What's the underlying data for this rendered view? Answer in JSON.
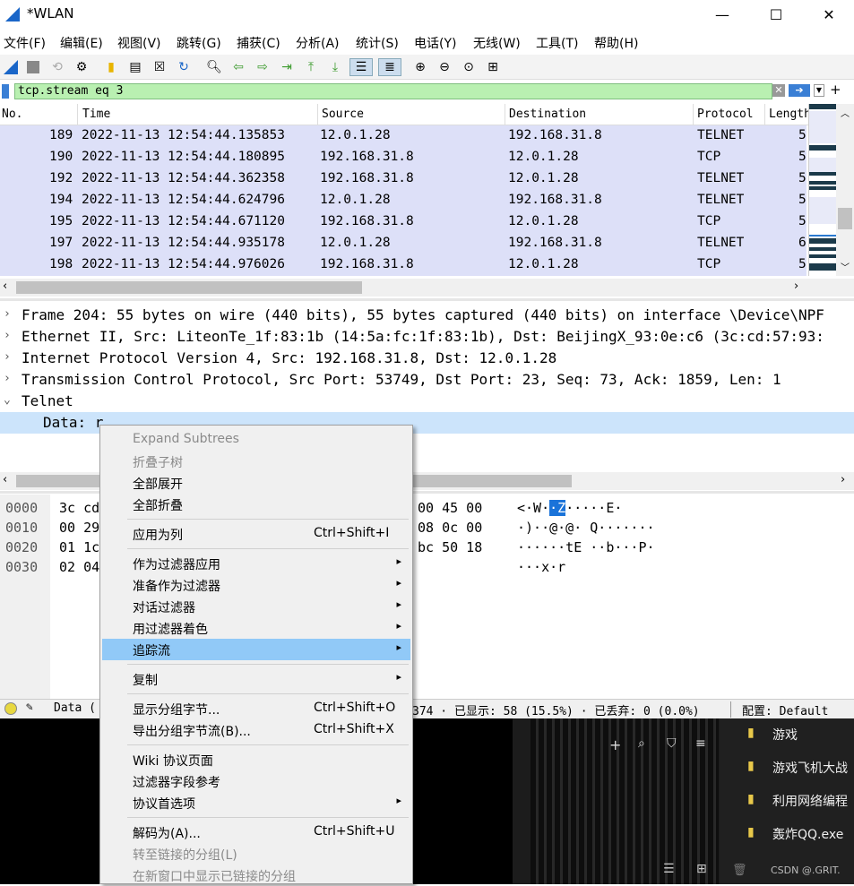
{
  "window": {
    "title": "*WLAN",
    "minimize": "—",
    "maximize": "☐",
    "close": "✕"
  },
  "menubar": [
    "文件(F)",
    "编辑(E)",
    "视图(V)",
    "跳转(G)",
    "捕获(C)",
    "分析(A)",
    "统计(S)",
    "电话(Y)",
    "无线(W)",
    "工具(T)",
    "帮助(H)"
  ],
  "filter": {
    "value": "tcp.stream eq 3",
    "plus": "+"
  },
  "packet_list": {
    "columns": [
      "No.",
      "Time",
      "Source",
      "Destination",
      "Protocol",
      "Length"
    ],
    "rows": [
      {
        "no": "189",
        "time": "2022-11-13 12:54:44.135853",
        "src": "12.0.1.28",
        "dst": "192.168.31.8",
        "proto": "TELNET",
        "len": "5"
      },
      {
        "no": "190",
        "time": "2022-11-13 12:54:44.180895",
        "src": "192.168.31.8",
        "dst": "12.0.1.28",
        "proto": "TCP",
        "len": "5"
      },
      {
        "no": "192",
        "time": "2022-11-13 12:54:44.362358",
        "src": "192.168.31.8",
        "dst": "12.0.1.28",
        "proto": "TELNET",
        "len": "5"
      },
      {
        "no": "194",
        "time": "2022-11-13 12:54:44.624796",
        "src": "12.0.1.28",
        "dst": "192.168.31.8",
        "proto": "TELNET",
        "len": "5"
      },
      {
        "no": "195",
        "time": "2022-11-13 12:54:44.671120",
        "src": "192.168.31.8",
        "dst": "12.0.1.28",
        "proto": "TCP",
        "len": "5"
      },
      {
        "no": "197",
        "time": "2022-11-13 12:54:44.935178",
        "src": "12.0.1.28",
        "dst": "192.168.31.8",
        "proto": "TELNET",
        "len": "6"
      },
      {
        "no": "198",
        "time": "2022-11-13 12:54:44.976026",
        "src": "192.168.31.8",
        "dst": "12.0.1.28",
        "proto": "TCP",
        "len": "5"
      }
    ]
  },
  "details": {
    "frame": "Frame 204: 55 bytes on wire (440 bits), 55 bytes captured (440 bits) on interface \\Device\\NPF",
    "ethernet": "Ethernet II, Src: LiteonTe_1f:83:1b (14:5a:fc:1f:83:1b), Dst: BeijingX_93:0e:c6 (3c:cd:57:93:",
    "ip": "Internet Protocol Version 4, Src: 192.168.31.8, Dst: 12.0.1.28",
    "tcp": "Transmission Control Protocol, Src Port: 53749, Dst Port: 23, Seq: 73, Ack: 1859, Len: 1",
    "telnet": "Telnet",
    "data": "Data: r"
  },
  "bytes": {
    "offsets": [
      "0000",
      "0010",
      "0020",
      "0030"
    ],
    "hex_left": [
      "3c cd",
      "00 29",
      "01 1c",
      "02 04"
    ],
    "hex_right": [
      "00 45 00",
      "08 0c 00",
      "bc 50 18",
      ""
    ],
    "ascii_pre": [
      "<·W·",
      "·)··@·@·",
      "······tE",
      "···x·r"
    ],
    "ascii_hl": [
      "·Z",
      "",
      "",
      ""
    ],
    "ascii_post": [
      "·····E·",
      " Q·······",
      " ··b···P·",
      ""
    ]
  },
  "status": {
    "field": "Data (",
    "mid": "374 · 已显示: 58 (15.5%) · 已丢弃: 0 (0.0%)",
    "profile": "配置: Default"
  },
  "explorer": {
    "items": [
      "游戏",
      "游戏飞机大战",
      "利用网络编程",
      "轰炸QQ.exe"
    ],
    "watermark": "CSDN @.GRIT."
  },
  "context_menu": {
    "items": [
      {
        "label": "Expand Subtrees",
        "disabled": true
      },
      {
        "label": "折叠子树",
        "disabled": true
      },
      {
        "label": "全部展开"
      },
      {
        "label": "全部折叠"
      },
      {
        "sep": true
      },
      {
        "label": "应用为列",
        "shortcut": "Ctrl+Shift+I"
      },
      {
        "sep": true
      },
      {
        "label": "作为过滤器应用",
        "submenu": true
      },
      {
        "label": "准备作为过滤器",
        "submenu": true
      },
      {
        "label": "对话过滤器",
        "submenu": true
      },
      {
        "label": "用过滤器着色",
        "submenu": true
      },
      {
        "label": "追踪流",
        "submenu": true,
        "highlight": true
      },
      {
        "sep": true
      },
      {
        "label": "复制",
        "submenu": true
      },
      {
        "sep": true
      },
      {
        "label": "显示分组字节...",
        "shortcut": "Ctrl+Shift+O"
      },
      {
        "label": "导出分组字节流(B)...",
        "shortcut": "Ctrl+Shift+X"
      },
      {
        "sep": true
      },
      {
        "label": "Wiki 协议页面"
      },
      {
        "label": "过滤器字段参考"
      },
      {
        "label": "协议首选项",
        "submenu": true
      },
      {
        "sep": true
      },
      {
        "label": "解码为(A)...",
        "shortcut": "Ctrl+Shift+U"
      },
      {
        "label": "转至链接的分组(L)",
        "disabled": true
      },
      {
        "label": "在新窗口中显示已链接的分组",
        "disabled": true
      }
    ]
  },
  "colors": {
    "accent": "#91c9f7",
    "filter_ok": "#b9f0b1",
    "rows_bg": "#dde0f8"
  }
}
